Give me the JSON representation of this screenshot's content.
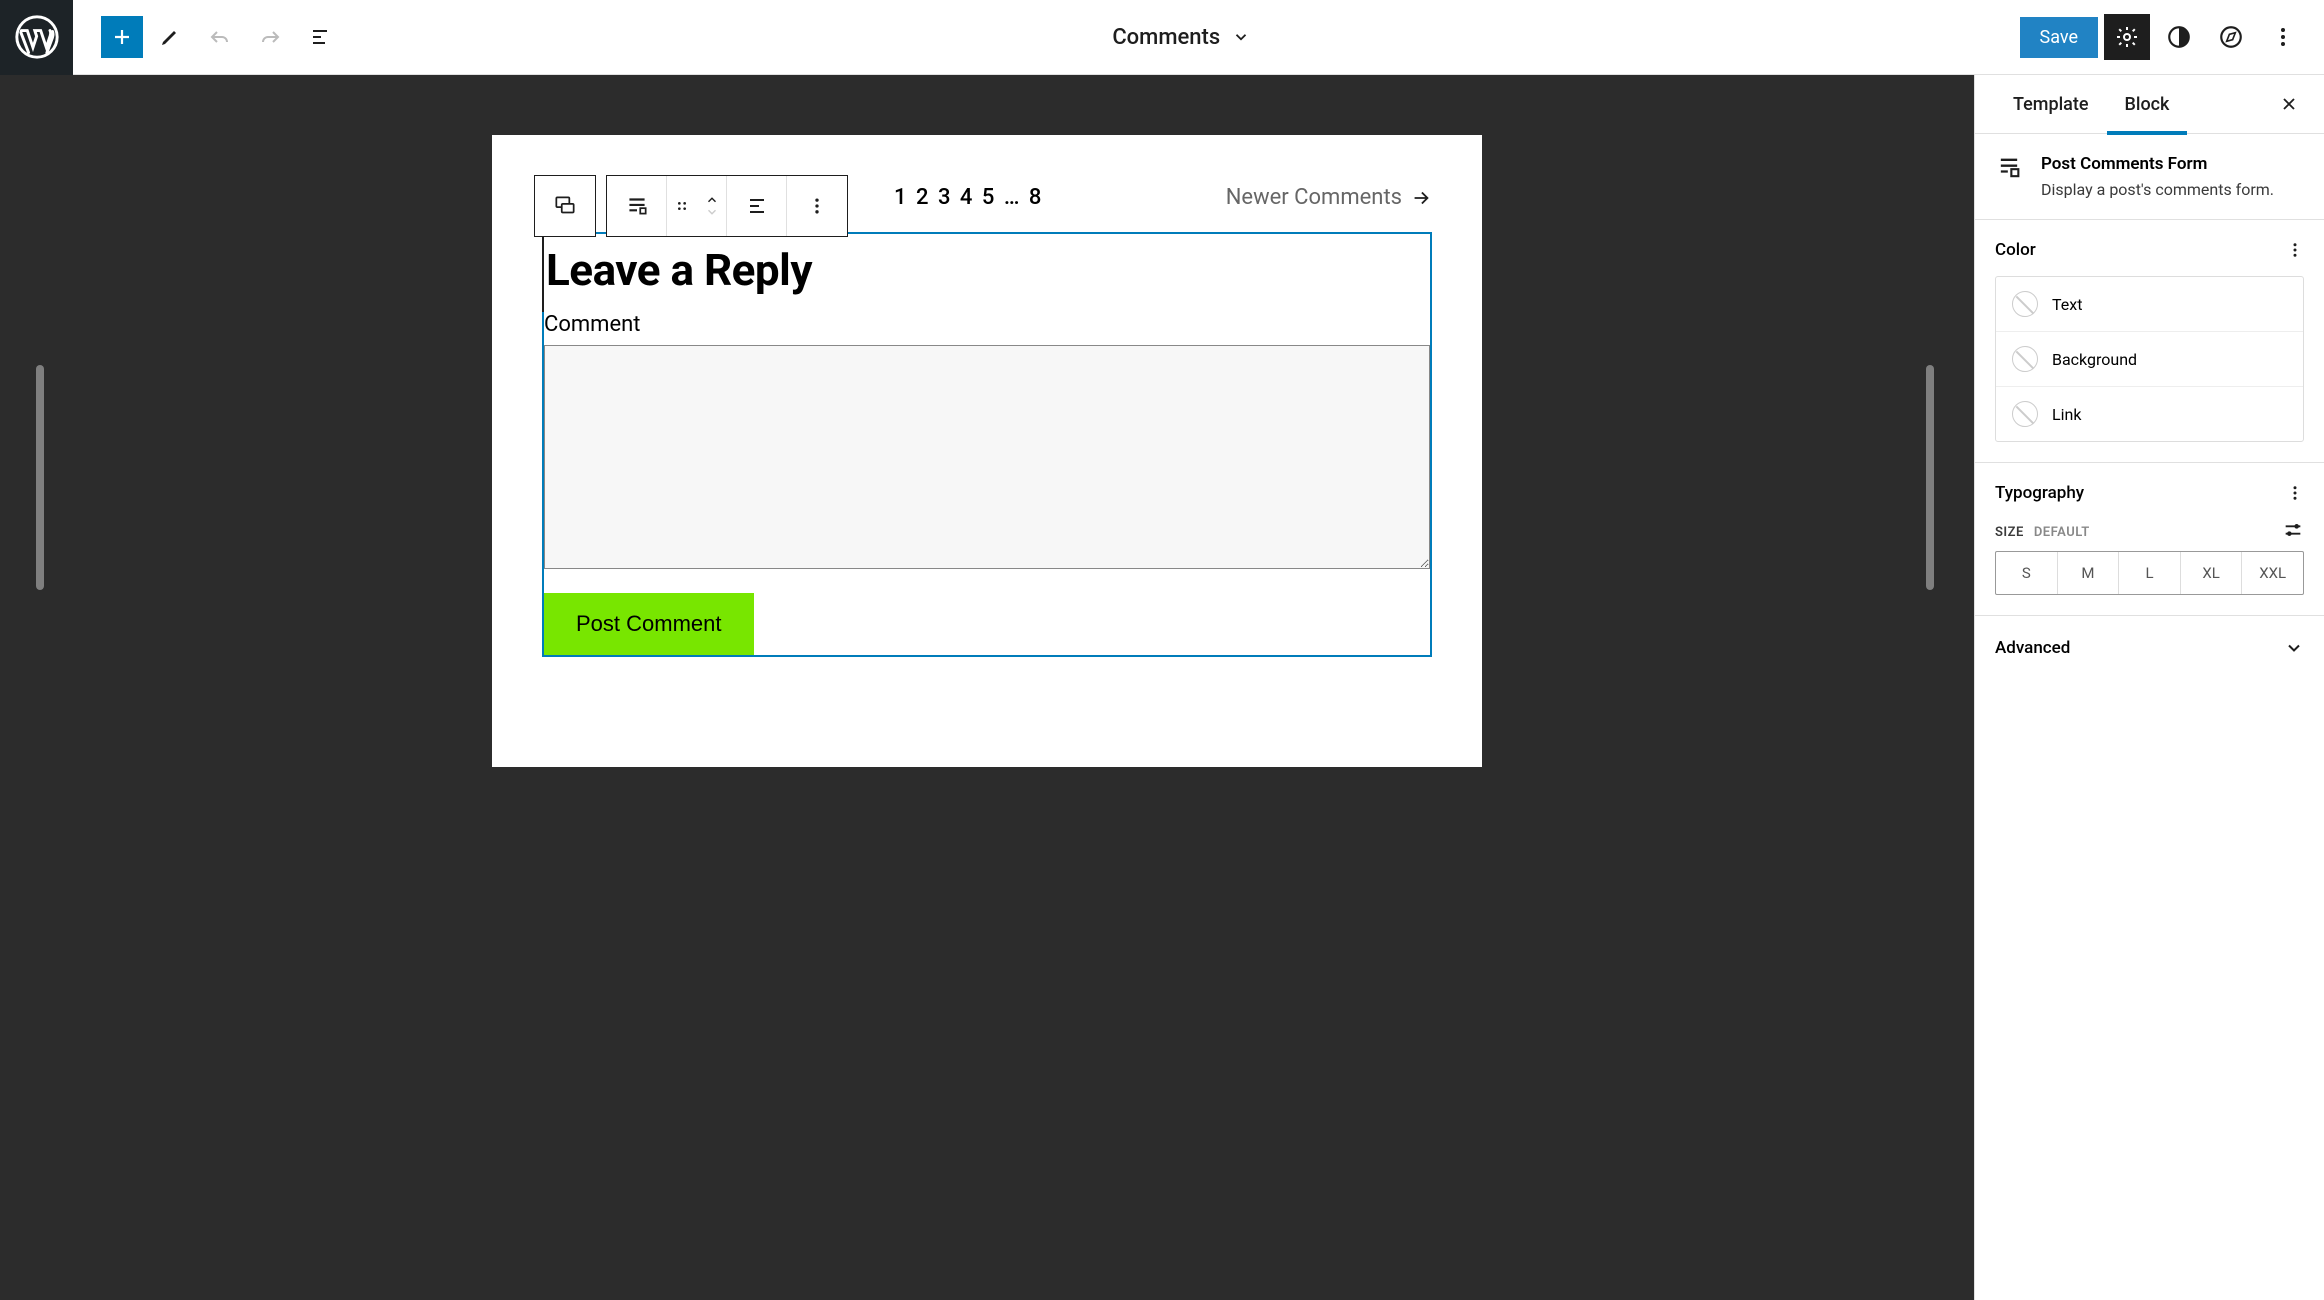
{
  "header": {
    "documentTitle": "Comments",
    "saveLabel": "Save"
  },
  "canvas": {
    "paginationNumbers": "1 2 3 4 5 … 8",
    "newerComments": "Newer Comments",
    "replyTitle": "Leave a Reply",
    "commentLabel": "Comment",
    "postCommentLabel": "Post Comment"
  },
  "sidebar": {
    "tabs": {
      "template": "Template",
      "block": "Block"
    },
    "blockHeader": {
      "title": "Post Comments Form",
      "description": "Display a post's comments form."
    },
    "panels": {
      "color": {
        "title": "Color",
        "items": {
          "text": "Text",
          "background": "Background",
          "link": "Link"
        }
      },
      "typography": {
        "title": "Typography",
        "sizeLabel": "SIZE",
        "sizeDefault": "DEFAULT",
        "sizes": {
          "s": "S",
          "m": "M",
          "l": "L",
          "xl": "XL",
          "xxl": "XXL"
        }
      },
      "advanced": {
        "title": "Advanced"
      }
    }
  }
}
